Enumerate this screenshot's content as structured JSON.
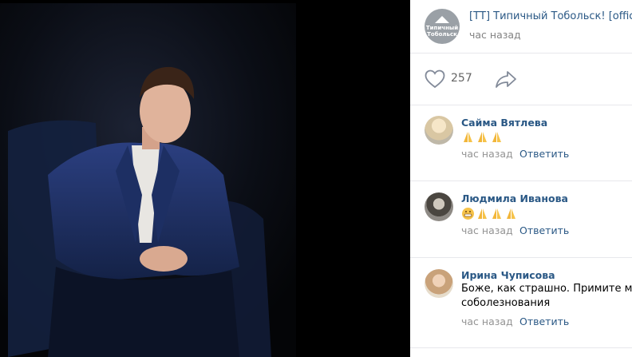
{
  "post": {
    "group_name": "[ТТ] Типичный Тобольск! [official]",
    "logo_text_1": "Типичный",
    "logo_text_2": "Тобольск",
    "time": "час назад",
    "likes": "257"
  },
  "comments": [
    {
      "author": "Сайма Вятлева",
      "text": "",
      "emoji": [
        "pray",
        "pray",
        "pray"
      ],
      "time": "час назад",
      "reply": "Ответить"
    },
    {
      "author": "Людмила Иванова",
      "text": "",
      "emoji": [
        "grin",
        "pray",
        "pray",
        "pray"
      ],
      "time": "час назад",
      "reply": "Ответить"
    },
    {
      "author": "Ирина Чуписова",
      "text_line1": "Боже, как страшно. Примите мои",
      "text_line2": "соболезнования",
      "time": "час назад",
      "reply": "Ответить"
    }
  ],
  "colors": {
    "link": "#2a5885",
    "muted": "#828282",
    "divider": "#e7e8ec"
  }
}
